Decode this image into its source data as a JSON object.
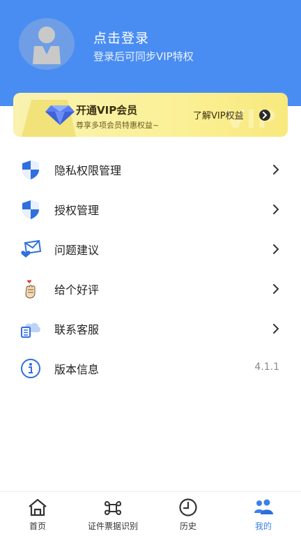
{
  "profile": {
    "title": "点击登录",
    "subtitle": "登录后可同步VIP特权"
  },
  "vip": {
    "title": "开通VIP会员",
    "subtitle": "尊享多项会员特惠权益~",
    "link": "了解VIP权益",
    "watermark": "VIP"
  },
  "menu": [
    {
      "label": "隐私权限管理",
      "icon": "shield-icon"
    },
    {
      "label": "授权管理",
      "icon": "shield-icon"
    },
    {
      "label": "问题建议",
      "icon": "feedback-mail-icon"
    },
    {
      "label": "给个好评",
      "icon": "finger-heart-icon"
    },
    {
      "label": "联系客服",
      "icon": "cloud-service-icon"
    },
    {
      "label": "版本信息",
      "icon": "info-icon",
      "value": "4.1.1"
    }
  ],
  "tabs": [
    {
      "label": "首页",
      "icon": "home-icon",
      "active": false
    },
    {
      "label": "证件票据识别",
      "icon": "command-icon",
      "active": false
    },
    {
      "label": "历史",
      "icon": "clock-icon",
      "active": false
    },
    {
      "label": "我的",
      "icon": "users-icon",
      "active": true
    }
  ],
  "colors": {
    "primary": "#4a8df2",
    "active_tab": "#3b82e8",
    "vip_gold": "#fbf199"
  }
}
